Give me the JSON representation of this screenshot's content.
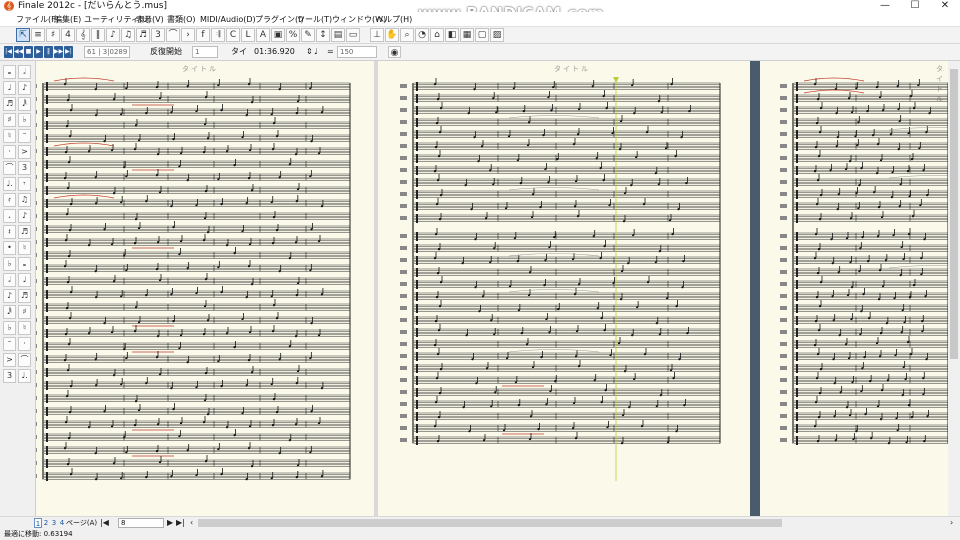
{
  "window": {
    "app_icon": "finale-logo-icon",
    "title": "Finale 2012c - [だいらんとう.mus]",
    "minimize_icon": "minimize-icon",
    "maximize_icon": "maximize-icon",
    "close_icon": "close-icon",
    "watermark": "www.BANDICAM.com"
  },
  "menu": [
    "ファイル(F)",
    "編集(E)",
    "ユーティリティ(U)",
    "表示(V)",
    "書類(O)",
    "MIDI/Audio(D)",
    "プラグイン(I)",
    "ツール(T)",
    "ウィンドウ(W)",
    "ヘルプ(H)"
  ],
  "playback": {
    "measure_field": "61 | 3|0289",
    "repeat_label": "反復開始",
    "repeat_value": "1",
    "time_label": "タイ",
    "time_value": "01:36.920",
    "equals": "=",
    "tempo": "150"
  },
  "pages": [
    {
      "title": "タイトル"
    },
    {
      "title": "タイトル"
    },
    {
      "title": "タイトル"
    }
  ],
  "pagebar": {
    "tabs": [
      "1",
      "2",
      "3",
      "4"
    ],
    "active_tab": "1",
    "page_label": "ページ(A)",
    "page_input": "8"
  },
  "status": "最適に移動: 0.63194",
  "colors": {
    "page_background": "#fbf9e9",
    "page_gap": "#4a5b6b",
    "playback_cursor": "#b6cf3c",
    "slur_red": "#c0392b",
    "active_tool": "#cfe2f8"
  }
}
